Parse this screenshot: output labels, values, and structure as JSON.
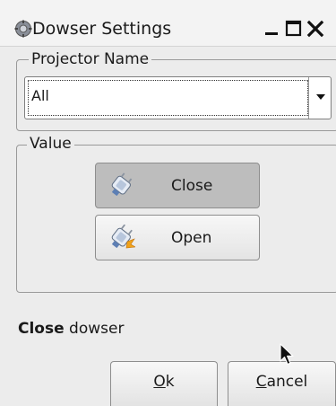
{
  "window": {
    "title": "Dowser Settings",
    "title_icon": "gear-icon",
    "controls": [
      "minimize-icon",
      "maximize-icon",
      "close-icon"
    ]
  },
  "projector": {
    "group_label": "Projector Name",
    "selected": "All"
  },
  "value": {
    "group_label": "Value",
    "buttons": [
      {
        "label": "Close",
        "icon": "plug-disconnected-icon",
        "pressed": true
      },
      {
        "label": "Open",
        "icon": "plug-connected-icon",
        "pressed": false
      }
    ]
  },
  "status": {
    "strong": "Close",
    "rest": " dowser"
  },
  "footer": {
    "ok_mnemonic": "O",
    "ok_rest": "k",
    "cancel_mnemonic": "C",
    "cancel_rest": "ancel"
  }
}
